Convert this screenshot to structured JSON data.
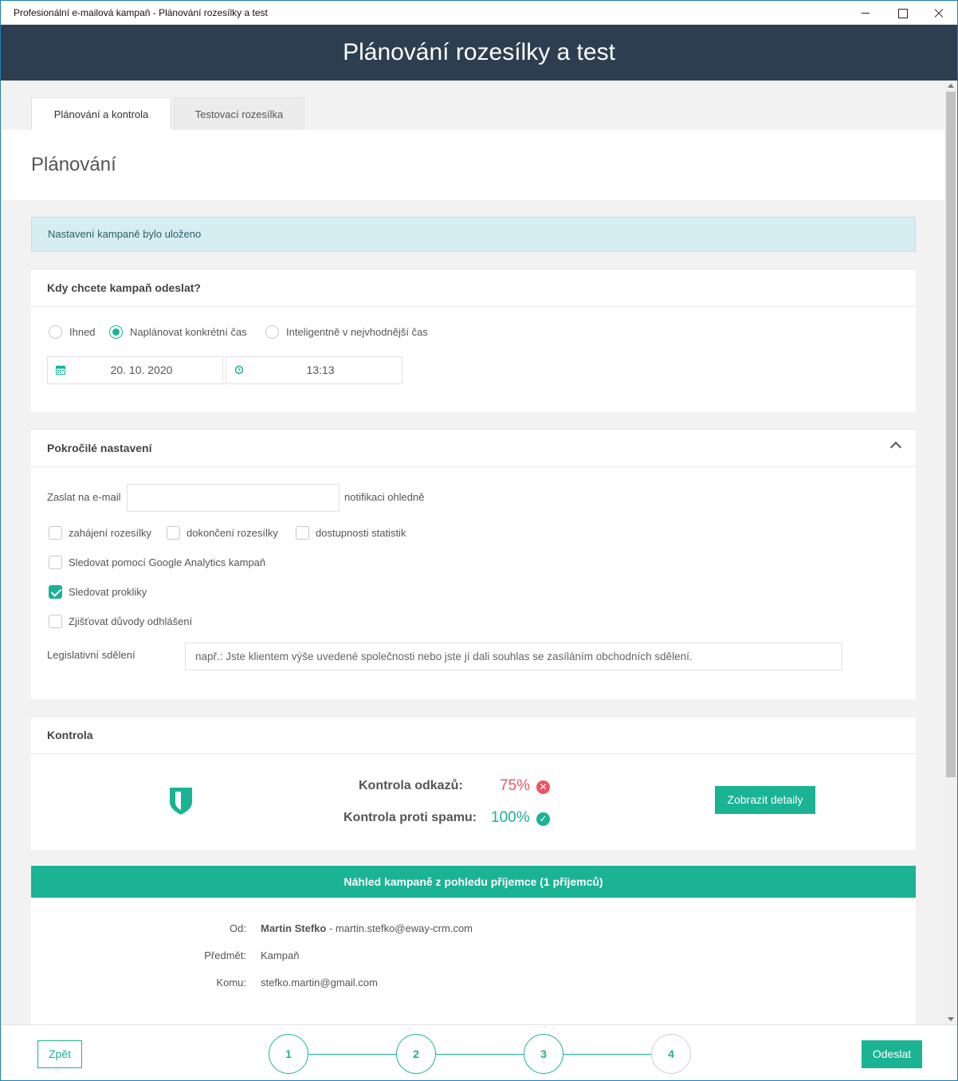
{
  "window": {
    "title": "Profesionální e-mailová kampaň - Plánování rozesílky a test"
  },
  "header": {
    "title": "Plánování rozesílky a test"
  },
  "tabs": [
    {
      "label": "Plánování a kontrola",
      "active": true
    },
    {
      "label": "Testovací rozesílka",
      "active": false
    }
  ],
  "page": {
    "heading": "Plánování"
  },
  "alert": {
    "text": "Nastavení kampaně bylo uloženo"
  },
  "schedule": {
    "title": "Kdy chcete kampaň odeslat?",
    "options": [
      {
        "label": "Ihned",
        "selected": false
      },
      {
        "label": "Naplánovat konkrétní čas",
        "selected": true
      },
      {
        "label": "Inteligentně v nejvhodnější čas",
        "selected": false
      }
    ],
    "date": "20. 10. 2020",
    "time": "13:13"
  },
  "advanced": {
    "title": "Pokročilé nastavení",
    "email_prefix": "Zaslat na e-mail",
    "email_value": "",
    "email_suffix": "notifikaci ohledně",
    "notify": [
      {
        "label": "zahájení rozesílky",
        "checked": false
      },
      {
        "label": "dokončení rozesílky",
        "checked": false
      },
      {
        "label": "dostupnosti statistik",
        "checked": false
      }
    ],
    "google_analytics": {
      "label": "Sledovat pomocí Google Analytics kampaň",
      "checked": false
    },
    "track_clicks": {
      "label": "Sledovat prokliky",
      "checked": true
    },
    "unsubscribe_reasons": {
      "label": "Zjišťovat důvody odhlášení",
      "checked": false
    },
    "legal_label": "Legislativní sdělení",
    "legal_placeholder": "např.: Jste klientem výše uvedené společnosti nebo jste jí dali souhlas se zasíláním obchodních sdělení."
  },
  "control": {
    "title": "Kontrola",
    "links_label": "Kontrola odkazů:",
    "links_value": "75%",
    "spam_label": "Kontrola proti spamu:",
    "spam_value": "100%",
    "details_button": "Zobrazit detaily",
    "colors": {
      "fail": "#ed5565",
      "ok": "#1ab394"
    }
  },
  "preview": {
    "title": "Náhled kampaně z pohledu příjemce (1 příjemců)",
    "from_label": "Od:",
    "from_name": "Martin Stefko",
    "from_email": " - martin.stefko@eway-crm.com",
    "subject_label": "Předmět:",
    "subject": "Kampaň",
    "to_label": "Komu:",
    "to": "stefko.martin@gmail.com"
  },
  "footer": {
    "back": "Zpět",
    "send": "Odeslat",
    "steps": [
      "1",
      "2",
      "3",
      "4"
    ]
  },
  "theme": {
    "accent": "#1ab394",
    "header_bg": "#2d3e50"
  }
}
